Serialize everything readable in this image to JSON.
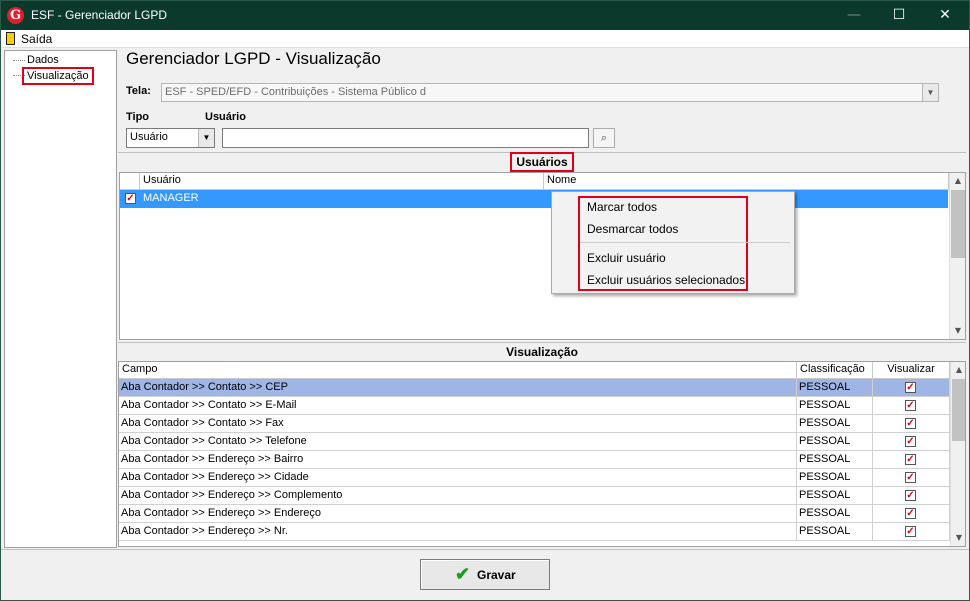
{
  "window": {
    "title": "ESF - Gerenciador LGPD",
    "logo": "G",
    "minimize": "—",
    "maximize": "☐",
    "close": "✕"
  },
  "menu": {
    "exit_label": "Saída"
  },
  "tree": {
    "items": [
      {
        "label": "Dados"
      },
      {
        "label": "Visualização",
        "selected": true
      }
    ]
  },
  "page": {
    "title": "Gerenciador LGPD - Visualização"
  },
  "screen_field": {
    "label": "Tela:",
    "value": "ESF - SPED/EFD - Contribuições - Sistema Público d"
  },
  "filters": {
    "type_label": "Tipo",
    "type_value": "Usuário",
    "user_label": "Usuário",
    "user_value": ""
  },
  "users_panel": {
    "title": "Usuários",
    "columns": [
      "Usuário",
      "Nome"
    ],
    "rows": [
      {
        "checked": true,
        "user": "MANAGER",
        "name": ""
      }
    ]
  },
  "context_menu": {
    "items": [
      "Marcar todos",
      "Desmarcar todos",
      "Excluir usuário",
      "Excluir usuários selecionados"
    ]
  },
  "view_panel": {
    "title": "Visualização",
    "columns": [
      "Campo",
      "Classificação",
      "Visualizar"
    ],
    "rows": [
      {
        "field": "Aba Contador >> Contato >> CEP",
        "class": "PESSOAL",
        "view": true
      },
      {
        "field": "Aba Contador >> Contato >> E-Mail",
        "class": "PESSOAL",
        "view": true
      },
      {
        "field": "Aba Contador >> Contato >> Fax",
        "class": "PESSOAL",
        "view": true
      },
      {
        "field": "Aba Contador >> Contato >> Telefone",
        "class": "PESSOAL",
        "view": true
      },
      {
        "field": "Aba Contador >> Endereço >> Bairro",
        "class": "PESSOAL",
        "view": true
      },
      {
        "field": "Aba Contador >> Endereço >> Cidade",
        "class": "PESSOAL",
        "view": true
      },
      {
        "field": "Aba Contador >> Endereço >> Complemento",
        "class": "PESSOAL",
        "view": true
      },
      {
        "field": "Aba Contador >> Endereço >> Endereço",
        "class": "PESSOAL",
        "view": true
      },
      {
        "field": "Aba Contador >> Endereço >> Nr.",
        "class": "PESSOAL",
        "view": true
      }
    ]
  },
  "footer": {
    "save_label": "Gravar"
  },
  "colors": {
    "titlebar": "#0b3a2c",
    "highlight": "#e0001a",
    "selection": "#3399ff",
    "selected_row": "#9fb5e6"
  }
}
